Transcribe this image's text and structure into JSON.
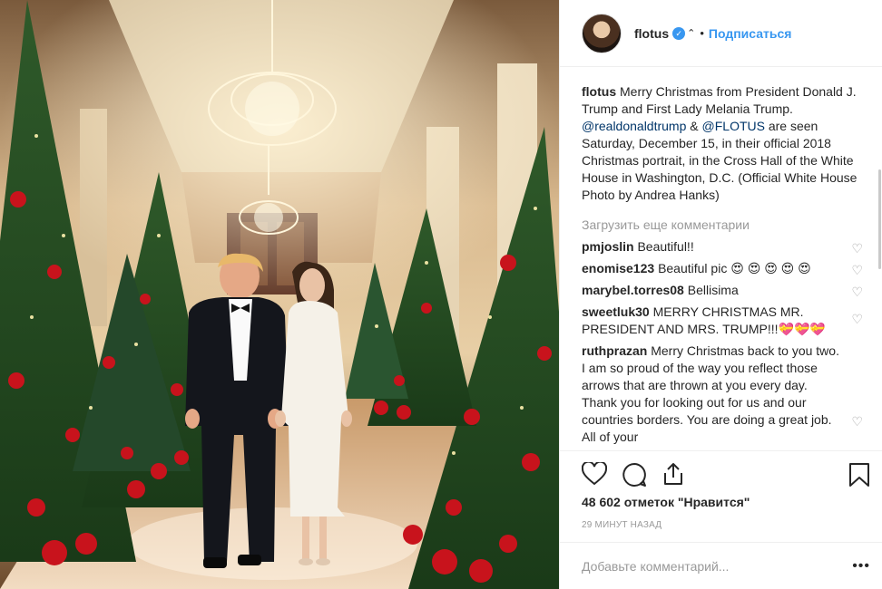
{
  "post": {
    "username": "flotus",
    "follow_label": "Подписаться",
    "dot": "•",
    "caption": {
      "username": "flotus",
      "text_1": "Merry Christmas from President Donald J. Trump and First Lady Melania Trump.",
      "mention_1": "@realdonaldtrump",
      "amp": "&",
      "mention_2": "@FLOTUS",
      "text_2": "are seen Saturday, December 15, in their official 2018 Christmas portrait, in the Cross Hall of the White House in Washington, D.C. (Official White House Photo by Andrea Hanks)"
    },
    "load_more": "Загрузить еще комментарии",
    "comments": [
      {
        "user": "pmjoslin",
        "text": "Beautiful!!"
      },
      {
        "user": "enomise123",
        "text": "Beautiful pic 😍 😍 😍 😍 😍"
      },
      {
        "user": "marybel.torres08",
        "text": "Bellisima"
      },
      {
        "user": "sweetluk30",
        "text": "MERRY CHRISTMAS MR. PRESIDENT AND MRS. TRUMP!!!💝💝💝"
      },
      {
        "user": "ruthprazan",
        "text": "Merry Christmas back to you two. I am so proud of the way you reflect those arrows that are thrown at you every day. Thank you for looking out for us and our countries borders. You are doing a great job. All of your"
      }
    ],
    "likes": "48 602 отметок \"Нравится\"",
    "time_ago": "29 минут назад",
    "add_comment_placeholder": "Добавьте комментарий...",
    "more_options": "•••"
  },
  "icons": {
    "like": "heart-icon",
    "comment": "comment-bubble-icon",
    "share": "share-icon",
    "save": "bookmark-icon",
    "verified": "verified-badge-icon"
  },
  "colors": {
    "link": "#3897f0",
    "mention": "#003569",
    "muted": "#999999"
  }
}
